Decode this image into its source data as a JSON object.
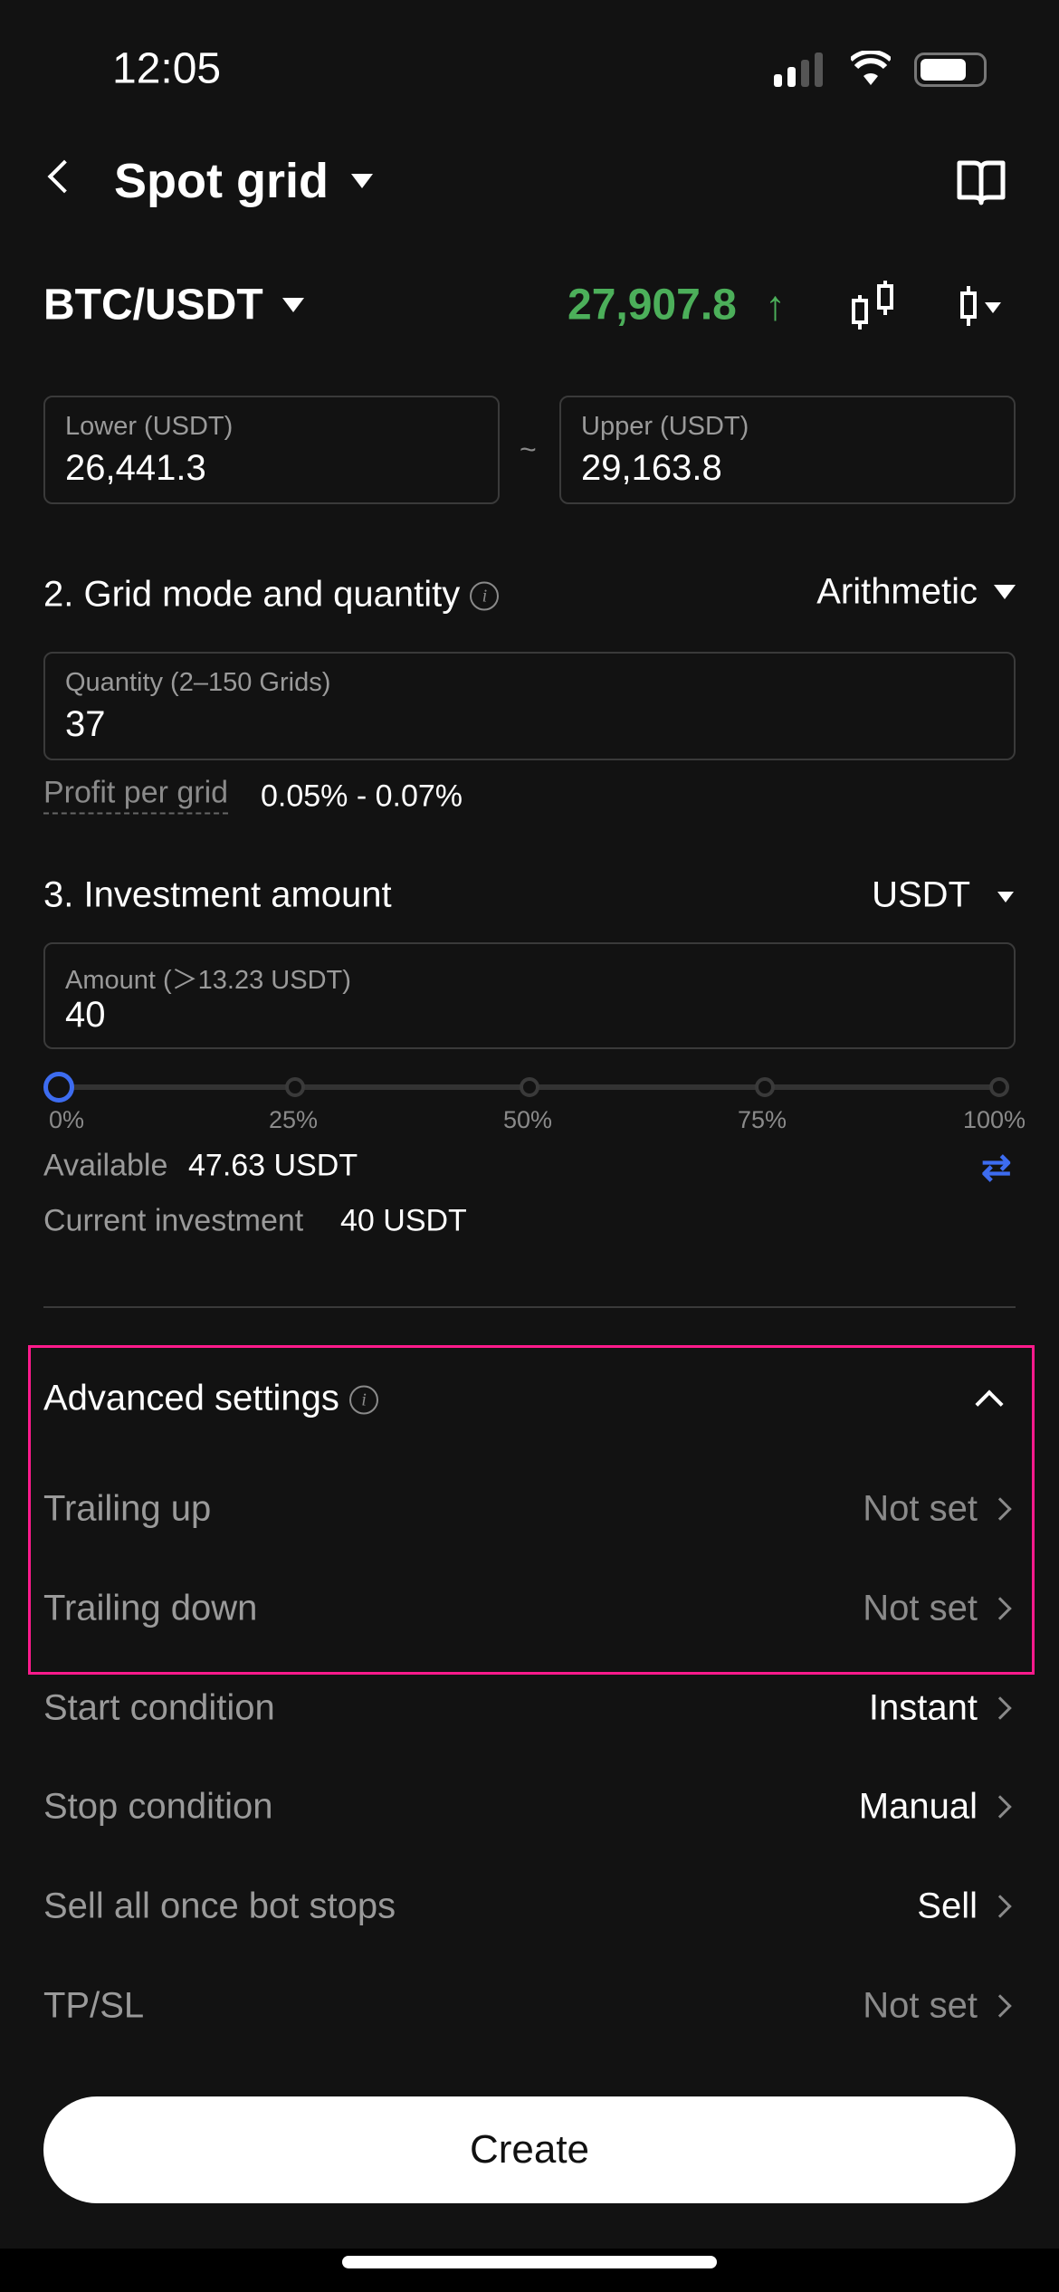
{
  "status": {
    "time": "12:05"
  },
  "header": {
    "title": "Spot grid"
  },
  "pair": {
    "name": "BTC/USDT",
    "price": "27,907.8",
    "price_color": "#4caf5a",
    "direction": "up"
  },
  "range": {
    "lower_label": "Lower (USDT)",
    "lower_value": "26,441.3",
    "separator": "~",
    "upper_label": "Upper (USDT)",
    "upper_value": "29,163.8"
  },
  "grid": {
    "title": "2. Grid mode and quantity",
    "mode": "Arithmetic",
    "quantity_label": "Quantity (2–150 Grids)",
    "quantity_value": "37",
    "profit_label": "Profit per grid",
    "profit_value": "0.05% - 0.07%"
  },
  "investment": {
    "title": "3. Investment amount",
    "currency": "USDT",
    "amount_label": "Amount (＞13.23 USDT)",
    "amount_value": "40",
    "slider_percent": 0,
    "slider_marks": [
      "0%",
      "25%",
      "50%",
      "75%",
      "100%"
    ],
    "available_label": "Available",
    "available_value": "47.63 USDT",
    "current_label": "Current investment",
    "current_value": "40 USDT",
    "accent": "#3d6cf0"
  },
  "advanced": {
    "title": "Advanced settings",
    "highlight": "#ff1a8c",
    "rows": [
      {
        "label": "Trailing up",
        "value": "Not set"
      },
      {
        "label": "Trailing down",
        "value": "Not set"
      }
    ]
  },
  "settings": [
    {
      "label": "Start condition",
      "value": "Instant"
    },
    {
      "label": "Stop condition",
      "value": "Manual"
    },
    {
      "label": "Sell all once bot stops",
      "value": "Sell"
    },
    {
      "label": "TP/SL",
      "value": "Not set"
    }
  ],
  "create_label": "Create"
}
